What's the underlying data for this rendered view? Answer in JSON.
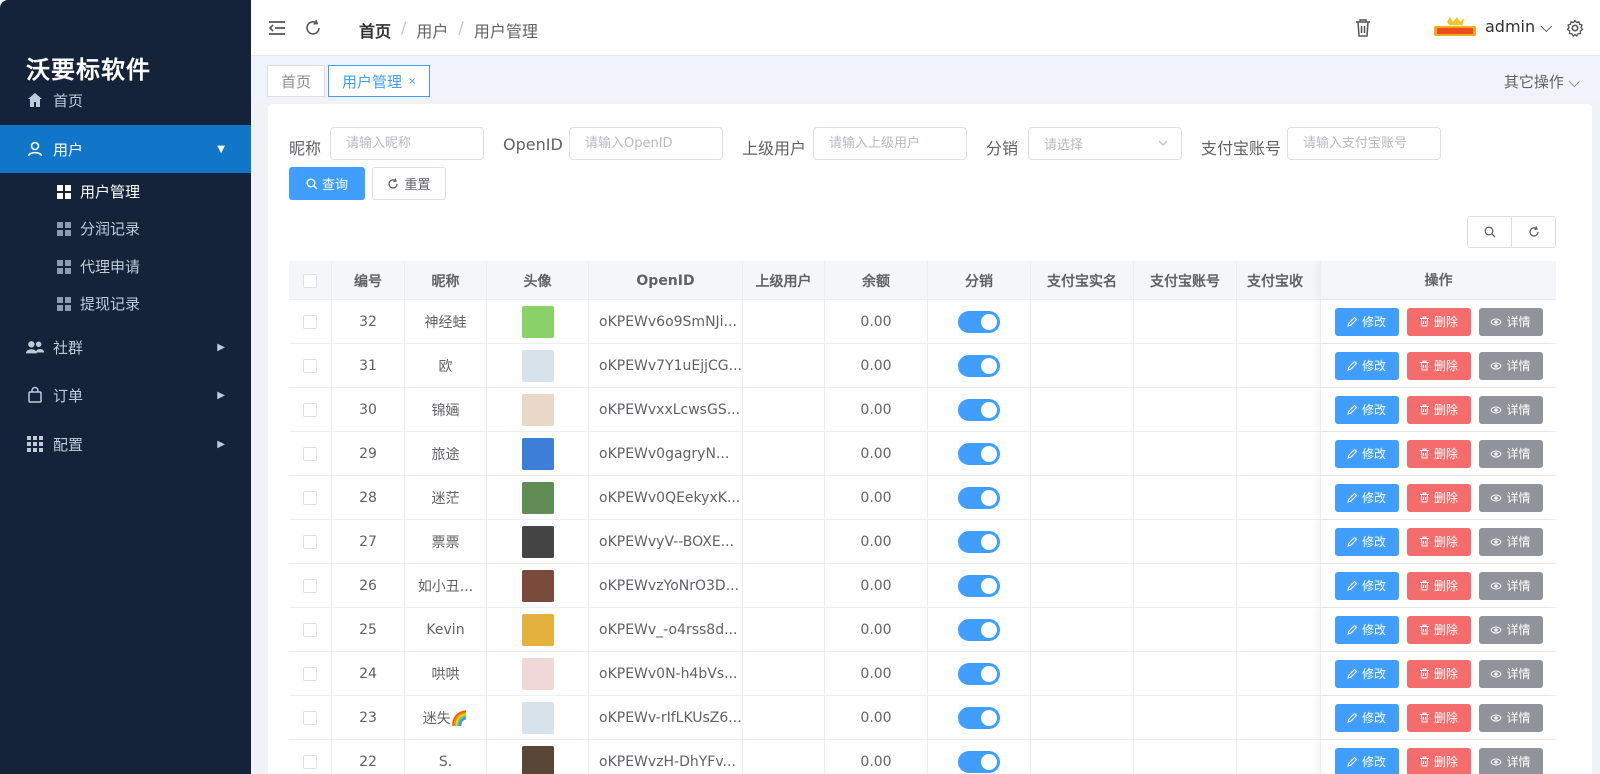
{
  "app": {
    "name": "沃要标软件"
  },
  "sidebar": {
    "home": "首页",
    "users": "用户",
    "users_sub": [
      "用户管理",
      "分润记录",
      "代理申请",
      "提现记录"
    ],
    "community": "社群",
    "orders": "订单",
    "config": "配置"
  },
  "header": {
    "breadcrumb": [
      "首页",
      "用户",
      "用户管理"
    ],
    "username": "admin"
  },
  "tags": {
    "home": "首页",
    "current": "用户管理",
    "close": "×",
    "more": "其它操作"
  },
  "filters": {
    "nickname_label": "昵称",
    "nickname_ph": "请输入昵称",
    "openid_label": "OpenID",
    "openid_ph": "请输入OpenID",
    "parent_label": "上级用户",
    "parent_ph": "请输入上级用户",
    "dist_label": "分销",
    "dist_ph": "请选择",
    "alipay_label": "支付宝账号",
    "alipay_ph": "请输入支付宝账号",
    "search": "查询",
    "reset": "重置"
  },
  "table": {
    "columns": [
      "编号",
      "昵称",
      "头像",
      "OpenID",
      "上级用户",
      "余额",
      "分销",
      "支付宝实名",
      "支付宝账号",
      "支付宝收",
      "操作"
    ],
    "actions": {
      "edit": "修改",
      "delete": "删除",
      "detail": "详情"
    },
    "rows": [
      {
        "id": "32",
        "nick": "神经蛙",
        "openid": "oKPEWv6o9SmNJi...",
        "parent": "",
        "balance": "0.00",
        "avatar_color": "#8bd16a"
      },
      {
        "id": "31",
        "nick": "欧",
        "openid": "oKPEWv7Y1uEjjCG...",
        "parent": "",
        "balance": "0.00",
        "avatar_color": "#d8e2ea"
      },
      {
        "id": "30",
        "nick": "锦婳",
        "openid": "oKPEWvxxLcwsGS...",
        "parent": "",
        "balance": "0.00",
        "avatar_color": "#e9d8c8"
      },
      {
        "id": "29",
        "nick": "旅途",
        "openid": "oKPEWv0gagryN...",
        "parent": "",
        "balance": "0.00",
        "avatar_color": "#3d7fd8"
      },
      {
        "id": "28",
        "nick": "迷茫",
        "openid": "oKPEWv0QEekyxK...",
        "parent": "",
        "balance": "0.00",
        "avatar_color": "#5f8d55"
      },
      {
        "id": "27",
        "nick": "票票",
        "openid": "oKPEWvyV--BOXE...",
        "parent": "",
        "balance": "0.00",
        "avatar_color": "#444444"
      },
      {
        "id": "26",
        "nick": "如小丑...",
        "openid": "oKPEWvzYoNrO3D...",
        "parent": "",
        "balance": "0.00",
        "avatar_color": "#7a4a3a"
      },
      {
        "id": "25",
        "nick": "Kevin",
        "openid": "oKPEWv_-o4rss8d...",
        "parent": "",
        "balance": "0.00",
        "avatar_color": "#e3b23c"
      },
      {
        "id": "24",
        "nick": "哄哄",
        "openid": "oKPEWv0N-h4bVs...",
        "parent": "",
        "balance": "0.00",
        "avatar_color": "#f0d8d8"
      },
      {
        "id": "23",
        "nick": "迷失🌈",
        "openid": "oKPEWv-rIfLKUsZ6...",
        "parent": "",
        "balance": "0.00",
        "avatar_color": "#d8e2ea"
      },
      {
        "id": "22",
        "nick": "S.",
        "openid": "oKPEWvzH-DhYFv...",
        "parent": "",
        "balance": "0.00",
        "avatar_color": "#5a4636"
      }
    ]
  },
  "colors": {
    "primary": "#409eff",
    "danger": "#f56c6c",
    "info": "#909399",
    "sidebar": "#14223a",
    "active_menu": "#1176c8"
  }
}
